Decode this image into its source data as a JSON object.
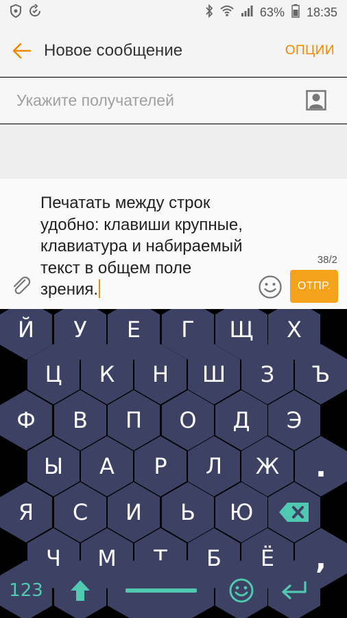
{
  "status_bar": {
    "battery_percent": "63%",
    "time": "18:35",
    "icons": [
      "shield-icon",
      "sync-icon",
      "bluetooth-icon",
      "wifi-icon",
      "signal-icon",
      "battery-icon"
    ]
  },
  "app_bar": {
    "title": "Новое сообщение",
    "options_label": "ОПЦИИ",
    "accent_color": "#f08a00"
  },
  "recipients": {
    "placeholder": "Укажите получателей"
  },
  "composer": {
    "message": "Печатать между строк удобно: клавиши крупные, клавиатура и набираемый текст в общем поле зрения.",
    "counter": "38/2",
    "send_label": "ОТПР.",
    "send_color": "#f5a31a"
  },
  "keyboard": {
    "rows": [
      [
        "Й",
        "У",
        "Е",
        "Г",
        "Щ",
        "Х"
      ],
      [
        "Ц",
        "К",
        "Н",
        "Ш",
        "З",
        "Ъ"
      ],
      [
        "Ф",
        "В",
        "П",
        "О",
        "Д",
        "Э"
      ],
      [
        "Ы",
        "А",
        "Р",
        "Л",
        "Ж",
        "."
      ],
      [
        "Я",
        "С",
        "И",
        "Ь",
        "Ю"
      ],
      [
        "Ч",
        "М",
        "Т",
        "Б",
        "Ё",
        ","
      ]
    ],
    "bottom_row": {
      "numbers_label": "123",
      "icons": [
        "shift-icon",
        "space-bar-icon",
        "emoji-icon",
        "enter-icon"
      ]
    },
    "backspace_icon": "backspace-icon",
    "key_color": "#3d4163",
    "special_color": "#4fc9b0"
  }
}
